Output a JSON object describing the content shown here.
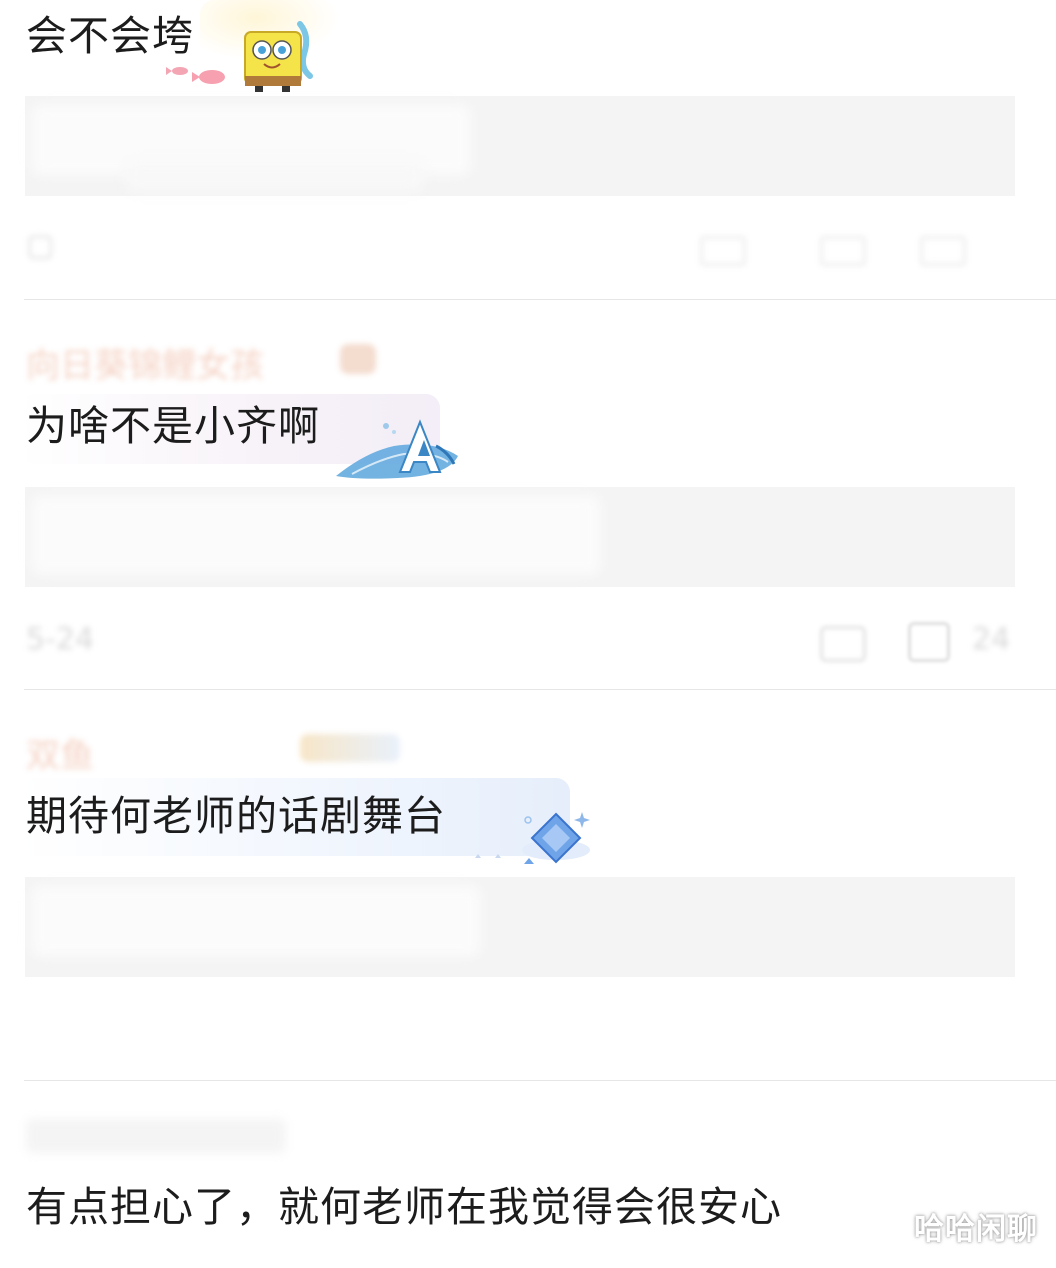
{
  "comments": [
    {
      "text": "会不会垮",
      "sticker": "spongebob-sticker"
    },
    {
      "user": "向日葵锦鲤女孩",
      "text": "为啥不是小齐啊",
      "sticker": "crystal-a-sticker",
      "meta_date": "5-24",
      "meta_count": "24"
    },
    {
      "user": "双鱼",
      "text": "期待何老师的话剧舞台",
      "sticker": "blue-diamond-sticker"
    },
    {
      "text": "有点担心了，就何老师在我觉得会很安心"
    }
  ],
  "watermark": "哈哈闲聊",
  "icons": {
    "meta_reply": "comment-icon",
    "meta_like": "like-icon"
  },
  "colors": {
    "username_faded": "#f2c6b4",
    "panel_gray": "#f4f4f4",
    "divider": "#e6e6e6"
  }
}
